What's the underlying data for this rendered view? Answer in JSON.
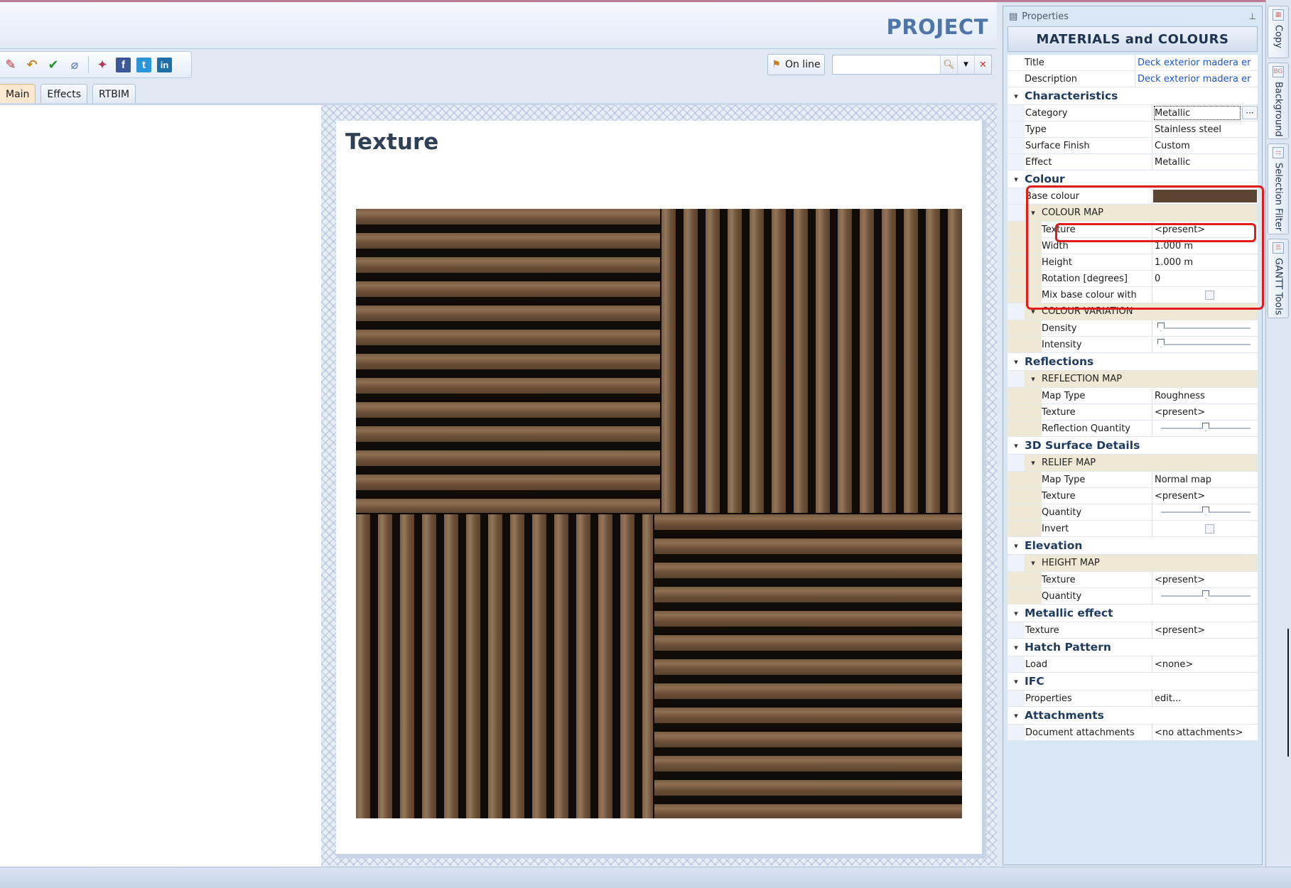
{
  "header": {
    "project_title": "PROJECT"
  },
  "toolbar": {
    "online_label": "On line",
    "search_placeholder": "",
    "icons": [
      "edit-icon",
      "undo-icon",
      "check-icon",
      "attach-icon",
      "web-icon",
      "facebook-icon",
      "twitter-icon",
      "linkedin-icon"
    ]
  },
  "tabs": [
    {
      "label": "Main",
      "active": true
    },
    {
      "label": "Effects",
      "active": false
    },
    {
      "label": "RTBIM",
      "active": false
    }
  ],
  "preview": {
    "title": "Texture"
  },
  "properties": {
    "panel_label": "Properties",
    "title": "MATERIALS and COLOURS",
    "general": [
      {
        "name": "Title",
        "value": "Deck exterior madera er"
      },
      {
        "name": "Description",
        "value": "Deck exterior madera er"
      }
    ],
    "characteristics": {
      "label": "Characteristics",
      "rows": [
        {
          "name": "Category",
          "value": "Metallic"
        },
        {
          "name": "Type",
          "value": "Stainless steel"
        },
        {
          "name": "Surface Finish",
          "value": "Custom"
        },
        {
          "name": "Effect",
          "value": "Metallic"
        }
      ]
    },
    "colour": {
      "label": "Colour",
      "base_colour_label": "Base colour",
      "base_colour_hex": "#5c4433",
      "colour_map": {
        "label": "COLOUR MAP",
        "rows": [
          {
            "name": "Texture",
            "value": "<present>"
          },
          {
            "name": "Width",
            "value": "1.000 m"
          },
          {
            "name": "Height",
            "value": "1.000 m"
          },
          {
            "name": "Rotation  [degrees]",
            "value": "0"
          }
        ],
        "mix_label": "Mix base colour with"
      },
      "colour_variation": {
        "label": "COLOUR VARIATION",
        "density_label": "Density",
        "density_level": 0,
        "intensity_label": "Intensity",
        "intensity_level": 0
      }
    },
    "reflections": {
      "label": "Reflections",
      "map_label": "REFLECTION MAP",
      "map_type_label": "Map Type",
      "map_type_value": "Roughness",
      "texture_label": "Texture",
      "texture_value": "<present>",
      "quantity_label": "Reflection Quantity",
      "quantity_level": 0.5
    },
    "surface": {
      "label": "3D Surface Details",
      "map_label": "RELIEF MAP",
      "map_type_label": "Map Type",
      "map_type_value": "Normal map",
      "texture_label": "Texture",
      "texture_value": "<present>",
      "quantity_label": "Quantity",
      "quantity_level": 0.5,
      "invert_label": "Invert"
    },
    "elevation": {
      "label": "Elevation",
      "map_label": "HEIGHT MAP",
      "texture_label": "Texture",
      "texture_value": "<present>",
      "quantity_label": "Quantity",
      "quantity_level": 0.5
    },
    "metallic": {
      "label": "Metallic effect",
      "texture_label": "Texture",
      "texture_value": "<present>"
    },
    "hatch": {
      "label": "Hatch Pattern",
      "load_label": "Load",
      "load_value": "<none>"
    },
    "ifc": {
      "label": "IFC",
      "properties_label": "Properties",
      "properties_value": "edit..."
    },
    "attachments": {
      "label": "Attachments",
      "doc_label": "Document attachments",
      "doc_value": "<no attachments>"
    }
  },
  "dock": [
    {
      "label": "Copy"
    },
    {
      "label": "Background"
    },
    {
      "label": "Selection Filter"
    },
    {
      "label": "GANTT Tools"
    }
  ],
  "colors": {
    "accent": "#4f75a6",
    "highlight": "#e31b1b",
    "wood_dark": "#3a2a1d",
    "wood_light": "#8a6b4e"
  }
}
